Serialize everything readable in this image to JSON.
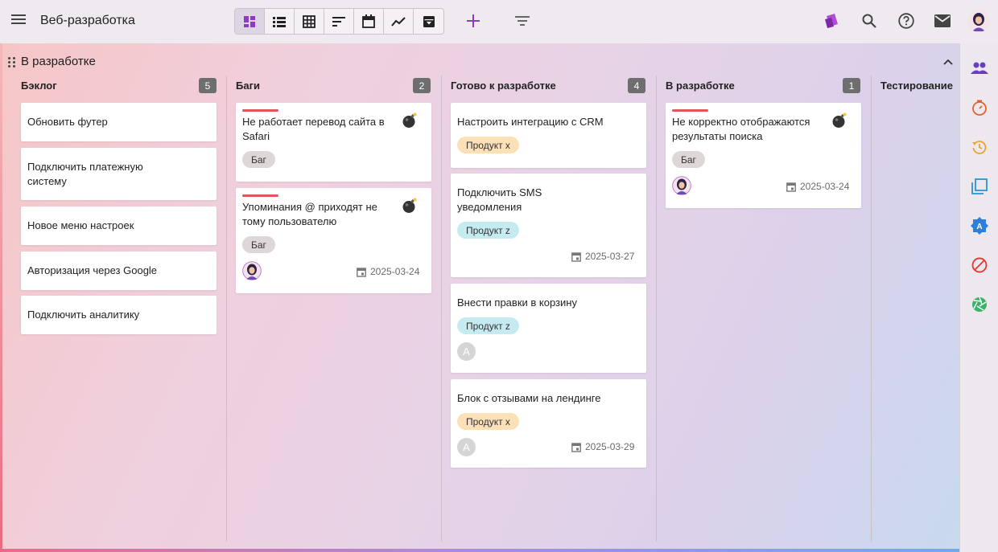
{
  "app": {
    "title": "Веб-разработка"
  },
  "toolbar": {
    "views": [
      "dashboard-icon",
      "list-icon",
      "table-icon",
      "sort-icon",
      "calendar-icon",
      "chart-icon",
      "archive-icon"
    ],
    "active_view": "dashboard-icon",
    "accent": "#8e3cbf"
  },
  "group": {
    "title": "В разработке"
  },
  "columns": [
    {
      "title": "Бэклог",
      "count": "5"
    },
    {
      "title": "Баги",
      "count": "2"
    },
    {
      "title": "Готово к разработке",
      "count": "4"
    },
    {
      "title": "В разработке",
      "count": "1"
    },
    {
      "title": "Тестирование",
      "count": ""
    }
  ],
  "cards": {
    "backlog": [
      {
        "title": "Обновить футер"
      },
      {
        "title_line1": "Подключить платежную",
        "title_line2": "систему"
      },
      {
        "title": "Новое меню настроек"
      },
      {
        "title": "Авторизация через Google"
      },
      {
        "title": "Подключить аналитику"
      }
    ],
    "bugs": [
      {
        "title_line1": "Не работает перевод сайта в",
        "title_line2": "Safari",
        "tag": "Баг"
      },
      {
        "title_line1": "Упоминания @ приходят не",
        "title_line2": "тому пользователю",
        "tag": "Баг",
        "date": "2025-03-24"
      }
    ],
    "ready": [
      {
        "title": "Настроить интеграцию с CRM",
        "tag": "Продукт x"
      },
      {
        "title_line1": "Подключить SMS",
        "title_line2": "уведомления",
        "tag": "Продукт z",
        "date": "2025-03-27"
      },
      {
        "title": "Внести правки в корзину",
        "tag": "Продукт z",
        "avatar": "A"
      },
      {
        "title": "Блок с отзывами на лендинге",
        "tag": "Продукт x",
        "avatar": "A",
        "date": "2025-03-29"
      }
    ],
    "in_progress": [
      {
        "title_line1": "Не корректно отображаются",
        "title_line2": "результаты поиска",
        "tag": "Баг",
        "date": "2025-03-24"
      }
    ]
  },
  "sidebar_icons": [
    "people-icon",
    "timer-icon",
    "history-icon",
    "layers-icon",
    "badge-a-icon",
    "block-icon",
    "aperture-icon"
  ]
}
